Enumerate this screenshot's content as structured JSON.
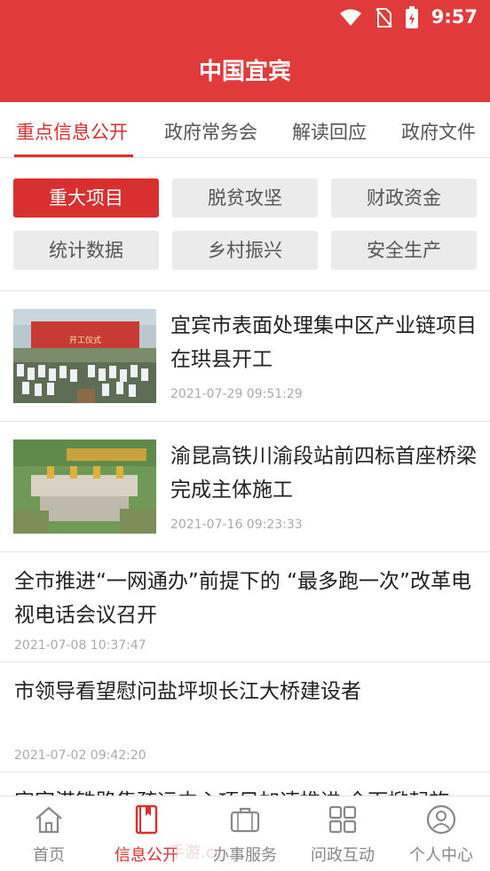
{
  "status_bar": {
    "time": "9:57",
    "icons": [
      "wifi-icon",
      "no-sim-icon",
      "battery-charging-icon"
    ]
  },
  "app_bar": {
    "title": "中国宜宾"
  },
  "tabs": [
    {
      "label": "重点信息公开",
      "active": true
    },
    {
      "label": "政府常务会",
      "active": false
    },
    {
      "label": "解读回应",
      "active": false
    },
    {
      "label": "政府文件",
      "active": false
    }
  ],
  "categories": [
    {
      "label": "重大项目",
      "active": true
    },
    {
      "label": "脱贫攻坚",
      "active": false
    },
    {
      "label": "财政资金",
      "active": false
    },
    {
      "label": "统计数据",
      "active": false
    },
    {
      "label": "乡村振兴",
      "active": false
    },
    {
      "label": "安全生产",
      "active": false
    }
  ],
  "news": [
    {
      "title": "宜宾市表面处理集中区产业链项目在珙县开工",
      "date": "2021-07-29 09:51:29",
      "thumb_banner": "开工仪式"
    },
    {
      "title": "渝昆高铁川渝段站前四标首座桥梁完成主体施工",
      "date": "2021-07-16 09:23:33"
    },
    {
      "title": "全市推进“一网通办”前提下的 “最多跑一次”改革电视电话会议召开",
      "date": "2021-07-08 10:37:47"
    },
    {
      "title": "市领导看望慰问盐坪坝长江大桥建设者",
      "date": "2021-07-02 09:42:20"
    },
    {
      "title": "宜宾港铁路集疏运中心项目加速推进 全面掀起施"
    }
  ],
  "bottom_nav": [
    {
      "label": "首页",
      "icon": "home-icon",
      "active": false
    },
    {
      "label": "信息公开",
      "icon": "book-icon",
      "active": true
    },
    {
      "label": "办事服务",
      "icon": "briefcase-icon",
      "active": false
    },
    {
      "label": "问政互动",
      "icon": "grid-icon",
      "active": false
    },
    {
      "label": "个人中心",
      "icon": "user-icon",
      "active": false
    }
  ],
  "watermark": "手游.cc",
  "colors": {
    "brand_red": "#e03a3a",
    "active_red": "#d82f2f",
    "chip_gray": "#ebebeb",
    "date_gray": "#aaaaaa"
  }
}
